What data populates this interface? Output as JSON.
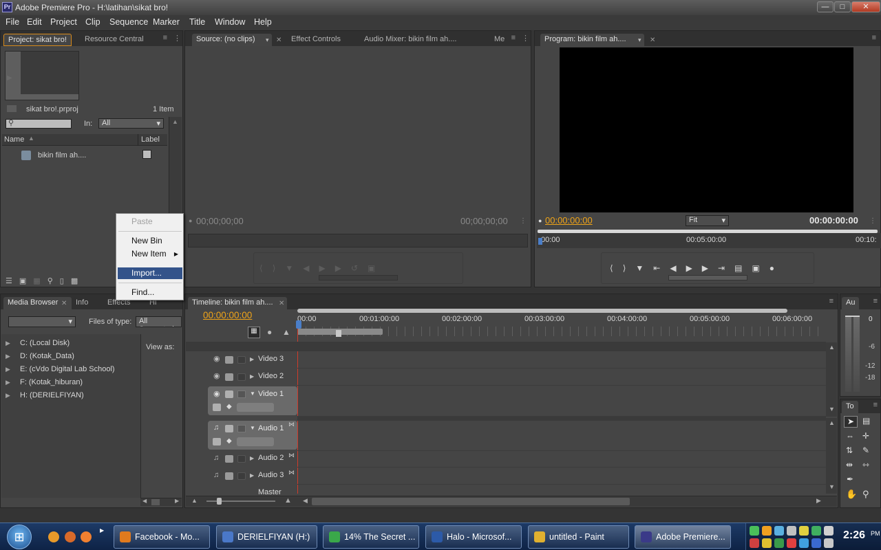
{
  "window": {
    "title": "Adobe Premiere Pro - H:\\latihan\\sikat bro!",
    "app_icon": "Pr",
    "minimize": "—",
    "maximize": "□",
    "close": "✕"
  },
  "menu": [
    "File",
    "Edit",
    "Project",
    "Clip",
    "Sequence",
    "Marker",
    "Title",
    "Window",
    "Help"
  ],
  "project_panel": {
    "tab_project": "Project: sikat bro!",
    "tab_resource": "Resource Central",
    "filename": "sikat bro!.prproj",
    "item_count": "1 Item",
    "in_label": "In:",
    "in_value": "All",
    "col_name": "Name",
    "col_label": "Label",
    "item_name": "bikin film ah...."
  },
  "context_menu": {
    "paste": "Paste",
    "new_bin": "New Bin",
    "new_item": "New Item",
    "import": "Import...",
    "find": "Find..."
  },
  "source_panel": {
    "tab_source": "Source: (no clips)",
    "tab_effect_controls": "Effect Controls",
    "tab_audio_mixer": "Audio Mixer: bikin film ah....",
    "tab_more": "Me",
    "tc_in": "00;00;00;00",
    "tc_out": "00;00;00;00"
  },
  "program_panel": {
    "tab": "Program: bikin film ah....",
    "tc_current": "00:00:00:00",
    "fit": "Fit",
    "tc_duration": "00:00:00:00",
    "ruler": [
      "00:00",
      "00:05:00:00",
      "00:10:"
    ]
  },
  "media_browser": {
    "tab_media": "Media Browser",
    "tab_info": "Info",
    "tab_effects": "Effects",
    "tab_more": "Hi",
    "files_of_type": "Files of type:",
    "file_type_value": "All Supported",
    "view_as": "View as:",
    "drives": [
      "C: (Local Disk)",
      "D: (Kotak_Data)",
      "E: (cVdo Digital Lab School)",
      "F: (Kotak_hiburan)",
      "H: (DERIELFIYAN)"
    ]
  },
  "timeline": {
    "tab": "Timeline: bikin film ah....",
    "timecode": "00:00:00:00",
    "ruler": [
      "00:00",
      "00:01:00:00",
      "00:02:00:00",
      "00:03:00:00",
      "00:04:00:00",
      "00:05:00:00",
      "00:06:00:00"
    ],
    "video_tracks": [
      "Video 3",
      "Video 2",
      "Video 1"
    ],
    "audio_tracks": [
      "Audio 1",
      "Audio 2",
      "Audio 3",
      "Master"
    ]
  },
  "audio_meter": {
    "tab": "Au",
    "labels": [
      "0",
      "-6",
      "-12",
      "-18"
    ]
  },
  "tools_panel": {
    "tab": "To"
  },
  "taskbar": {
    "start": "⊞",
    "buttons": [
      "Facebook - Mo...",
      "DERIELFIYAN (H:)",
      "14% The Secret ...",
      "Halo - Microsof...",
      "untitled - Paint",
      "Adobe Premiere..."
    ],
    "clock": "2:26",
    "clock_suffix": "PM"
  },
  "colors": {
    "accent_timecode": "#f0a418",
    "selection": "#33538a",
    "playhead": "#cf3b2b"
  }
}
